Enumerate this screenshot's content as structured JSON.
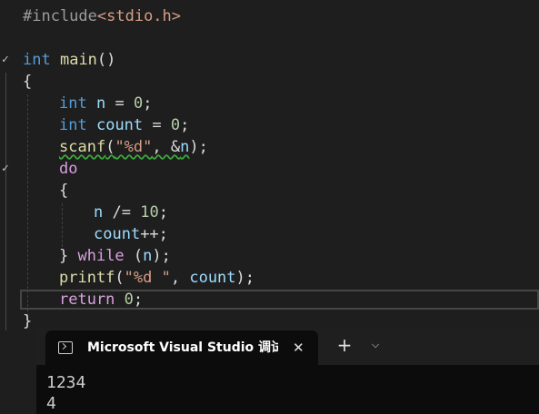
{
  "editor": {
    "lines": [
      {
        "pp": "#include",
        "inc": "<stdio.h>"
      },
      {
        "kw": "int",
        "fn": "main",
        "rest": "()"
      },
      {
        "text": "{"
      },
      {
        "kw": "int",
        "var": "n",
        "op": " = ",
        "num": "0",
        "end": ";"
      },
      {
        "kw": "int",
        "var": "count",
        "op": " = ",
        "num": "0",
        "end": ";"
      },
      {
        "fn": "scanf",
        "open": "(",
        "str": "\"%d\"",
        "sep": ", &",
        "var": "n",
        "close": ");"
      },
      {
        "kw2": "do"
      },
      {
        "text": "{"
      },
      {
        "var": "n",
        "op": " /= ",
        "num": "10",
        "end": ";"
      },
      {
        "var": "count",
        "end": "++;"
      },
      {
        "close": "} ",
        "kw2": "while",
        "open": " (",
        "var": "n",
        "end": ");"
      },
      {
        "fn": "printf",
        "open": "(",
        "str": "\"%d \"",
        "sep": ", ",
        "var": "count",
        "end": ");"
      },
      {
        "kw2": "return",
        "sep": " ",
        "num": "0",
        "end": ";"
      },
      {
        "text": "}"
      }
    ],
    "fold_icons": [
      "chevron-down",
      "chevron-down"
    ]
  },
  "terminal": {
    "tab_title": "Microsoft Visual Studio 调试控制台",
    "close_glyph": "✕",
    "new_tab_glyph": "+",
    "menu_glyph": "⌵",
    "output": [
      "1234",
      "4"
    ],
    "colors": {
      "background": "#0c0c0c",
      "tabstrip": "#1f1f1f",
      "text": "#cccccc"
    }
  }
}
